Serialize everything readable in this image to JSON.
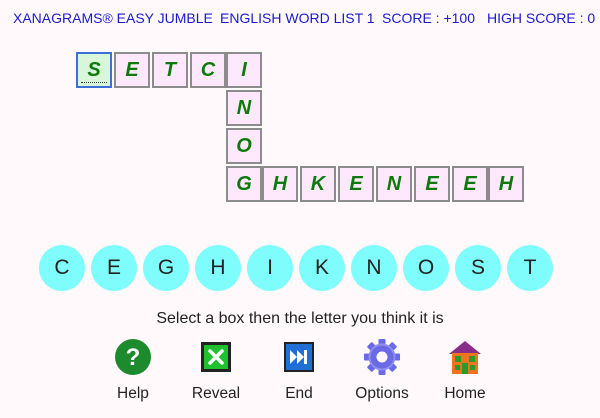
{
  "header": {
    "title": "XANAGRAMS® EASY JUMBLE",
    "word_list": "ENGLISH WORD LIST 1",
    "score": "SCORE : +100",
    "high_score": "HIGH SCORE : 0"
  },
  "grid": {
    "across_top": [
      "S",
      "E",
      "T",
      "C",
      "I"
    ],
    "down": [
      "N",
      "O"
    ],
    "across_bottom": [
      "G",
      "H",
      "K",
      "E",
      "N",
      "E",
      "E",
      "H"
    ],
    "selected_cell": "S"
  },
  "letters": [
    "C",
    "E",
    "G",
    "H",
    "I",
    "K",
    "N",
    "O",
    "S",
    "T"
  ],
  "instruction": "Select a box then the letter you think it is",
  "toolbar": {
    "help": "Help",
    "reveal": "Reveal",
    "end": "End",
    "options": "Options",
    "home": "Home"
  },
  "colors": {
    "header_text": "#1a1acc",
    "cell_bg": "#fde9fb",
    "cell_letter": "#0e7a0e",
    "selected_cell_bg": "#d8f6d8",
    "circle_bg": "#7ffcfc"
  }
}
